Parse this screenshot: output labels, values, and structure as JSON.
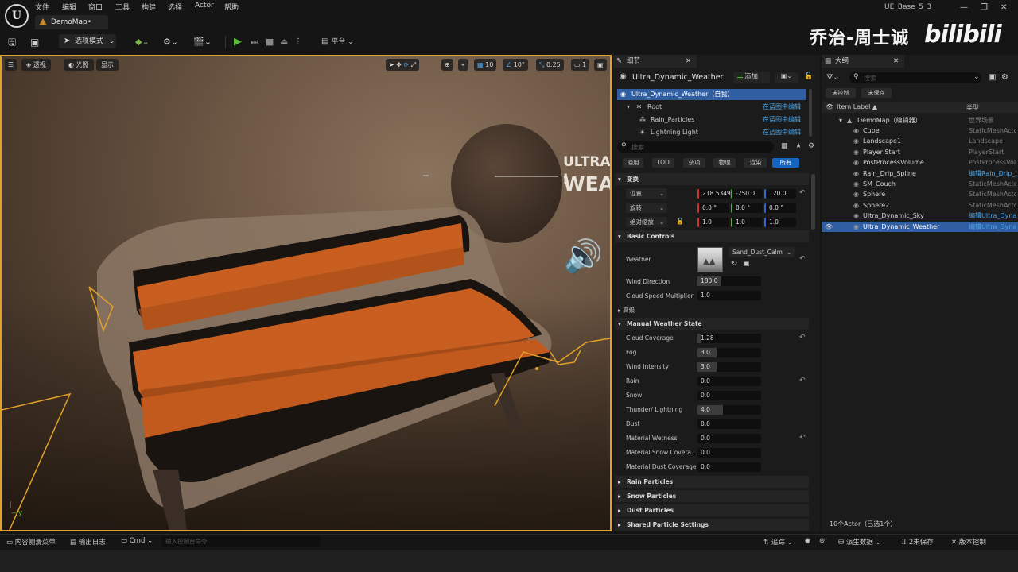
{
  "titlebar": {
    "menu": [
      "文件",
      "编辑",
      "窗口",
      "工具",
      "构建",
      "选择",
      "Actor",
      "帮助"
    ],
    "logo_text": "U",
    "document_tab": "DemoMap•",
    "project_name": "UE_Base_5_3",
    "window_buttons": [
      "—",
      "❐",
      "✕"
    ],
    "watermark_name": "乔治-周士诚",
    "watermark_logo": "bilibili"
  },
  "toolbar": {
    "select_mode": "选项模式",
    "platform": "平台"
  },
  "viewport": {
    "left_chips": [
      "透视",
      "光照",
      "显示"
    ],
    "grid_value": "10",
    "angle_value": "10°",
    "scale_value": "0.25",
    "camera_speed": "1",
    "banner_line1": "ULTRA I",
    "banner_line2": "WEA"
  },
  "details": {
    "tab_label": "细节",
    "actor_name": "Ultra_Dynamic_Weather",
    "add_label": "添加",
    "components": [
      {
        "name": "Ultra_Dynamic_Weather（自我）",
        "link": ""
      },
      {
        "name": "Root",
        "link": "在蓝图中编辑"
      },
      {
        "name": "Rain_Particles",
        "link": "在蓝图中编辑"
      },
      {
        "name": "Lightning Light",
        "link": "在蓝图中编辑"
      }
    ],
    "search_placeholder": "搜索",
    "filter_tabs": [
      "通用",
      "LOD",
      "杂项",
      "物理",
      "渲染",
      "所有"
    ],
    "transform_header": "变换",
    "transform": [
      {
        "label": "位置",
        "x": "218.5349",
        "y": "-250.0",
        "z": "120.0"
      },
      {
        "label": "旋转",
        "x": "0.0 °",
        "y": "0.0 °",
        "z": "0.0 °"
      },
      {
        "label": "绝对缩放",
        "x": "1.0",
        "y": "1.0",
        "z": "1.0"
      }
    ],
    "basic_controls_header": "Basic Controls",
    "weather_label": "Weather",
    "weather_value": "Sand_Dust_Calm",
    "wind_direction_label": "Wind Direction",
    "wind_direction_value": "180.0",
    "cloud_speed_label": "Cloud Speed Multiplier",
    "cloud_speed_value": "1.0",
    "advanced_label": "高级",
    "manual_header": "Manual Weather State",
    "manual": [
      {
        "label": "Cloud Coverage",
        "value": "1.28",
        "fill": 0.05
      },
      {
        "label": "Fog",
        "value": "3.0",
        "fill": 0.3
      },
      {
        "label": "Wind Intensity",
        "value": "3.0",
        "fill": 0.3
      },
      {
        "label": "Rain",
        "value": "0.0",
        "fill": 0
      },
      {
        "label": "Snow",
        "value": "0.0",
        "fill": 0
      },
      {
        "label": "Thunder/ Lightning",
        "value": "4.0",
        "fill": 0.4
      },
      {
        "label": "Dust",
        "value": "0.0",
        "fill": 0
      },
      {
        "label": "Material Wetness",
        "value": "0.0",
        "fill": 0
      },
      {
        "label": "Material Snow Covera...",
        "value": "0.0",
        "fill": 0
      },
      {
        "label": "Material Dust Coverage",
        "value": "0.0",
        "fill": 0
      }
    ],
    "collapsed_sections": [
      "Rain Particles",
      "Snow Particles",
      "Dust Particles",
      "Shared Particle Settings"
    ]
  },
  "outliner": {
    "tab_label": "大纲",
    "search_placeholder": "搜索",
    "chips": [
      "未控制",
      "未保存"
    ],
    "col_label": "Item Label ▲",
    "col_type": "类型",
    "root": {
      "name": "DemoMap（编辑器）",
      "type": "世界场景"
    },
    "items": [
      {
        "name": "Cube",
        "type": "StaticMeshActor",
        "link": false
      },
      {
        "name": "Landscape1",
        "type": "Landscape",
        "link": false
      },
      {
        "name": "Player Start",
        "type": "PlayerStart",
        "link": false
      },
      {
        "name": "PostProcessVolume",
        "type": "PostProcessVolume",
        "link": false
      },
      {
        "name": "Rain_Drip_Spline",
        "type": "编辑Rain_Drip_Spline",
        "link": true
      },
      {
        "name": "SM_Couch",
        "type": "StaticMeshActor",
        "link": false
      },
      {
        "name": "Sphere",
        "type": "StaticMeshActor",
        "link": false
      },
      {
        "name": "Sphere2",
        "type": "StaticMeshActor",
        "link": false
      },
      {
        "name": "Ultra_Dynamic_Sky",
        "type": "编辑Ultra_Dynamic_Sky",
        "link": true
      },
      {
        "name": "Ultra_Dynamic_Weather",
        "type": "编辑Ultra_Dynamic_Weather",
        "link": true,
        "selected": true
      }
    ],
    "footer": "10个Actor（已选1个）"
  },
  "statusbar": {
    "content_drawer": "内容侧滑菜单",
    "output_log": "输出日志",
    "cmd": "Cmd",
    "console_placeholder": "输入控制台命令",
    "trace": "追踪",
    "derived_data": "派生数据",
    "unsaved": "2未保存",
    "source_control": "版本控制"
  },
  "colors": {
    "accent_orange": "#e3a12b",
    "selection_blue": "#2f5ea3",
    "link_blue": "#4da4e6",
    "bench_orange": "#c85f20"
  }
}
